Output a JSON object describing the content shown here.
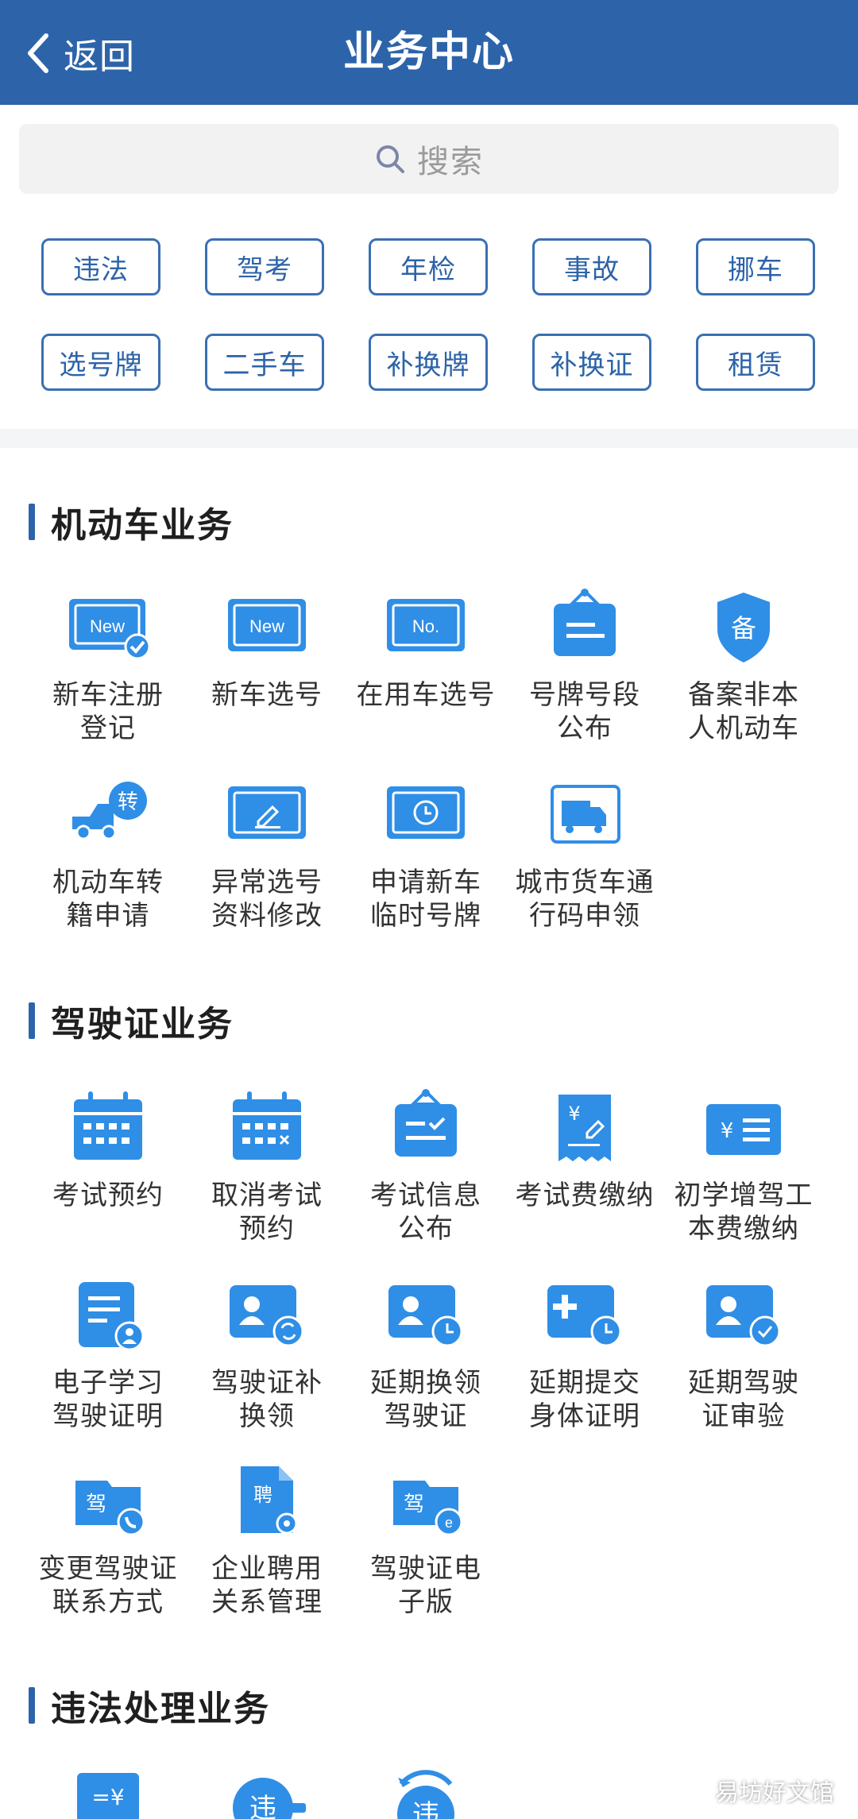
{
  "header": {
    "back_label": "返回",
    "title": "业务中心"
  },
  "search": {
    "placeholder": "搜索"
  },
  "tags": [
    "违法",
    "驾考",
    "年检",
    "事故",
    "挪车",
    "选号牌",
    "二手车",
    "补换牌",
    "补换证",
    "租赁"
  ],
  "sections": {
    "vehicle": {
      "title": "机动车业务",
      "items": [
        {
          "label": "新车注册\n登记",
          "icon": "new-register-icon"
        },
        {
          "label": "新车选号",
          "icon": "new-plate-icon"
        },
        {
          "label": "在用车选号",
          "icon": "no-plate-icon"
        },
        {
          "label": "号牌号段\n公布",
          "icon": "announcement-icon"
        },
        {
          "label": "备案非本\n人机动车",
          "icon": "filing-shield-icon"
        },
        {
          "label": "机动车转\n籍申请",
          "icon": "truck-transfer-icon"
        },
        {
          "label": "异常选号\n资料修改",
          "icon": "plate-edit-icon"
        },
        {
          "label": "申请新车\n临时号牌",
          "icon": "plate-clock-icon"
        },
        {
          "label": "城市货车通\n行码申领",
          "icon": "city-truck-icon"
        }
      ]
    },
    "license": {
      "title": "驾驶证业务",
      "items": [
        {
          "label": "考试预约",
          "icon": "calendar-icon"
        },
        {
          "label": "取消考试\n预约",
          "icon": "calendar-cancel-icon"
        },
        {
          "label": "考试信息\n公布",
          "icon": "exam-notice-icon"
        },
        {
          "label": "考试费缴纳",
          "icon": "fee-receipt-icon"
        },
        {
          "label": "初学增驾工\n本费缴纳",
          "icon": "fee-card-icon"
        },
        {
          "label": "电子学习\n驾驶证明",
          "icon": "study-certificate-icon"
        },
        {
          "label": "驾驶证补\n换领",
          "icon": "license-renew-icon"
        },
        {
          "label": "延期换领\n驾驶证",
          "icon": "license-delay-icon"
        },
        {
          "label": "延期提交\n身体证明",
          "icon": "health-delay-icon"
        },
        {
          "label": "延期驾驶\n证审验",
          "icon": "license-verify-icon"
        },
        {
          "label": "变更驾驶证\n联系方式",
          "icon": "license-phone-icon"
        },
        {
          "label": "企业聘用\n关系管理",
          "icon": "employment-doc-icon"
        },
        {
          "label": "驾驶证电\n子版",
          "icon": "license-electronic-icon"
        }
      ]
    },
    "violation": {
      "title": "违法处理业务",
      "items": [
        {
          "label": "",
          "icon": "fine-payment-icon",
          "glyph": "=¥"
        },
        {
          "label": "",
          "icon": "violation-icon",
          "glyph": "违"
        },
        {
          "label": "",
          "icon": "violation-refresh-icon",
          "glyph": "违"
        }
      ]
    }
  },
  "watermark": "易坊好文馆",
  "colors": {
    "primary": "#2d64a9",
    "icon_blue": "#2f8ee6",
    "tag_border": "#3a6fb3"
  }
}
